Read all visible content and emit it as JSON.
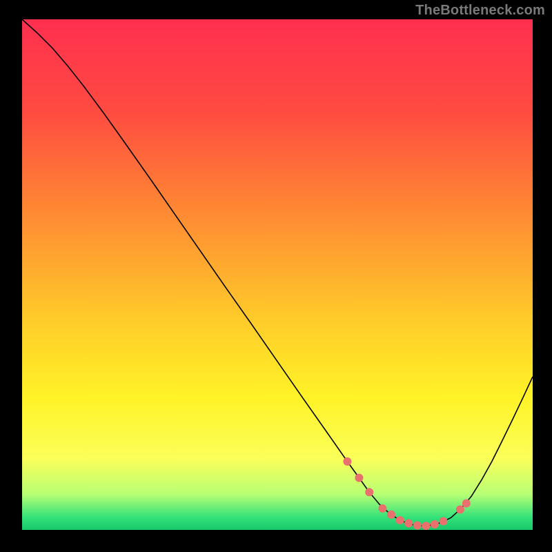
{
  "watermark": "TheBottleneck.com",
  "chart_data": {
    "type": "line",
    "title": "",
    "xlabel": "",
    "ylabel": "",
    "xlim": [
      0,
      100
    ],
    "ylim": [
      0,
      100
    ],
    "grid": false,
    "legend": false,
    "background_gradient": {
      "stops": [
        {
          "offset": 0.0,
          "color": "#ff2f4f"
        },
        {
          "offset": 0.18,
          "color": "#ff4b41"
        },
        {
          "offset": 0.38,
          "color": "#ff8a33"
        },
        {
          "offset": 0.58,
          "color": "#ffc92a"
        },
        {
          "offset": 0.74,
          "color": "#fff327"
        },
        {
          "offset": 0.86,
          "color": "#fbff59"
        },
        {
          "offset": 0.93,
          "color": "#b8ff74"
        },
        {
          "offset": 0.975,
          "color": "#34e27a"
        },
        {
          "offset": 1.0,
          "color": "#17c86a"
        }
      ]
    },
    "series": [
      {
        "name": "bottleneck-curve",
        "stroke": "#000000",
        "stroke_width": 1.6,
        "points": [
          {
            "x": 0.0,
            "y": 100.0
          },
          {
            "x": 3.0,
            "y": 97.3
          },
          {
            "x": 6.0,
            "y": 94.3
          },
          {
            "x": 9.0,
            "y": 90.8
          },
          {
            "x": 12.0,
            "y": 87.0
          },
          {
            "x": 16.0,
            "y": 81.6
          },
          {
            "x": 20.0,
            "y": 76.0
          },
          {
            "x": 25.0,
            "y": 68.9
          },
          {
            "x": 30.0,
            "y": 61.7
          },
          {
            "x": 35.0,
            "y": 54.5
          },
          {
            "x": 40.0,
            "y": 47.3
          },
          {
            "x": 45.0,
            "y": 40.2
          },
          {
            "x": 50.0,
            "y": 33.0
          },
          {
            "x": 55.0,
            "y": 25.8
          },
          {
            "x": 60.0,
            "y": 18.7
          },
          {
            "x": 63.7,
            "y": 13.4
          },
          {
            "x": 66.0,
            "y": 10.2
          },
          {
            "x": 68.0,
            "y": 7.4
          },
          {
            "x": 70.0,
            "y": 5.0
          },
          {
            "x": 72.0,
            "y": 3.2
          },
          {
            "x": 74.0,
            "y": 1.9
          },
          {
            "x": 76.0,
            "y": 1.1
          },
          {
            "x": 78.0,
            "y": 0.8
          },
          {
            "x": 80.0,
            "y": 0.9
          },
          {
            "x": 82.0,
            "y": 1.4
          },
          {
            "x": 84.0,
            "y": 2.4
          },
          {
            "x": 86.0,
            "y": 4.2
          },
          {
            "x": 88.0,
            "y": 6.6
          },
          {
            "x": 90.0,
            "y": 9.8
          },
          {
            "x": 92.0,
            "y": 13.4
          },
          {
            "x": 94.0,
            "y": 17.4
          },
          {
            "x": 96.0,
            "y": 21.5
          },
          {
            "x": 98.0,
            "y": 25.7
          },
          {
            "x": 100.0,
            "y": 30.0
          }
        ]
      },
      {
        "name": "sweet-spot-markers",
        "type": "scatter",
        "color": "#e9706d",
        "radius": 6,
        "points": [
          {
            "x": 63.7,
            "y": 13.4
          },
          {
            "x": 66.0,
            "y": 10.2
          },
          {
            "x": 68.0,
            "y": 7.4
          },
          {
            "x": 70.6,
            "y": 4.2
          },
          {
            "x": 72.3,
            "y": 3.0
          },
          {
            "x": 74.0,
            "y": 1.9
          },
          {
            "x": 75.7,
            "y": 1.3
          },
          {
            "x": 77.4,
            "y": 0.9
          },
          {
            "x": 79.1,
            "y": 0.8
          },
          {
            "x": 80.8,
            "y": 1.1
          },
          {
            "x": 82.5,
            "y": 1.7
          },
          {
            "x": 85.8,
            "y": 4.0
          },
          {
            "x": 87.0,
            "y": 5.2
          }
        ]
      }
    ]
  }
}
